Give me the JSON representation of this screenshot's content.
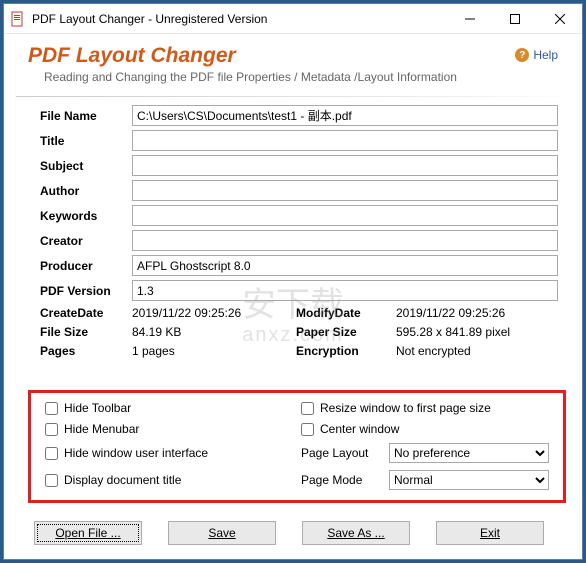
{
  "titlebar": {
    "text": "PDF Layout Changer - Unregistered Version"
  },
  "header": {
    "title": "PDF Layout Changer",
    "subtitle": "Reading and Changing the PDF file Properties / Metadata /Layout Information",
    "help_label": "Help"
  },
  "fields": {
    "file_name": {
      "label": "File Name",
      "value": "C:\\Users\\CS\\Documents\\test1 - 副本.pdf"
    },
    "title": {
      "label": "Title",
      "value": ""
    },
    "subject": {
      "label": "Subject",
      "value": ""
    },
    "author": {
      "label": "Author",
      "value": ""
    },
    "keywords": {
      "label": "Keywords",
      "value": ""
    },
    "creator": {
      "label": "Creator",
      "value": ""
    },
    "producer": {
      "label": "Producer",
      "value": "AFPL Ghostscript 8.0"
    },
    "pdf_version": {
      "label": "PDF Version",
      "value": "1.3"
    }
  },
  "info": {
    "create_date": {
      "label": "CreateDate",
      "value": "2019/11/22 09:25:26"
    },
    "modify_date": {
      "label": "ModifyDate",
      "value": "2019/11/22 09:25:26"
    },
    "file_size": {
      "label": "File Size",
      "value": "84.19 KB"
    },
    "paper_size": {
      "label": "Paper Size",
      "value": "595.28 x 841.89 pixel"
    },
    "pages": {
      "label": "Pages",
      "value": "1 pages"
    },
    "encryption": {
      "label": "Encryption",
      "value": "Not encrypted"
    }
  },
  "options": {
    "hide_toolbar": "Hide Toolbar",
    "hide_menubar": "Hide Menubar",
    "hide_ui": "Hide window user interface",
    "display_title": "Display document title",
    "resize_window": "Resize window to first page size",
    "center_window": "Center window",
    "page_layout": {
      "label": "Page Layout",
      "value": "No preference"
    },
    "page_mode": {
      "label": "Page Mode",
      "value": "Normal"
    }
  },
  "buttons": {
    "open": "Open File ...",
    "save": "Save",
    "save_as": "Save As ...",
    "exit": "Exit"
  },
  "watermark": {
    "line1": "安下载",
    "line2": "anxz.com"
  }
}
